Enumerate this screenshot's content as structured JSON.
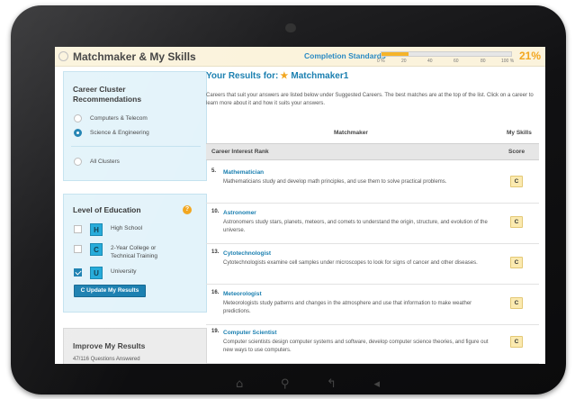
{
  "header": {
    "title": "Matchmaker & My Skills",
    "completion_label": "Completion Standards",
    "progress_percent": 21,
    "progress_text": "21%",
    "ticks": [
      "0 %",
      "20",
      "40",
      "60",
      "80",
      "100 %"
    ]
  },
  "sidebar": {
    "cluster_panel_title": "Career Cluster Recommendations",
    "clusters": [
      {
        "label": "Computers & Telecom",
        "selected": false
      },
      {
        "label": "Science & Engineering",
        "selected": true
      }
    ],
    "all_clusters_label": "All Clusters",
    "education_title": "Level of Education",
    "help_glyph": "?",
    "education_levels": [
      {
        "letter": "H",
        "label": "High School",
        "checked": false
      },
      {
        "letter": "C",
        "label": "2-Year College or Technical Training",
        "checked": false
      },
      {
        "letter": "U",
        "label": "University",
        "checked": true
      }
    ],
    "update_button": "C Update My Results",
    "improve_title": "Improve My Results",
    "questions_answered": "47/116 Questions Answered"
  },
  "main": {
    "results_prefix": "Your Results for:",
    "results_name": "Matchmaker1",
    "intro": "Careers that suit your answers are listed below under Suggested Careers. The best matches are at the top of the list. Click on a career to learn more about it and how it suits your answers.",
    "col_matchmaker": "Matchmaker",
    "col_myskills": "My Skills",
    "rank_header": "Career Interest Rank",
    "score_header": "Score",
    "careers": [
      {
        "rank": "5.",
        "name": "Mathematician",
        "desc": "Mathematicians study and develop math principles, and use them to solve practical problems.",
        "score": "C"
      },
      {
        "rank": "10.",
        "name": "Astronomer",
        "desc": "Astronomers study stars, planets, meteors, and comets to understand the origin, structure, and evolution of the universe.",
        "score": "C"
      },
      {
        "rank": "13.",
        "name": "Cytotechnologist",
        "desc": "Cytotechnologists examine cell samples under microscopes to look for signs of cancer and other diseases.",
        "score": "C"
      },
      {
        "rank": "16.",
        "name": "Meteorologist",
        "desc": "Meteorologists study patterns and changes in the atmosphere and use that information to make weather predictions.",
        "score": "C"
      },
      {
        "rank": "19.",
        "name": "Computer Scientist",
        "desc": "Computer scientists design computer systems and software, develop computer science theories, and figure out new ways to use computers.",
        "score": "C"
      }
    ]
  },
  "colors": {
    "accent": "#1a7fb0",
    "highlight": "#f2a61f",
    "header_bg": "#fbf3dc",
    "panel_bg": "#e3f3fa"
  }
}
